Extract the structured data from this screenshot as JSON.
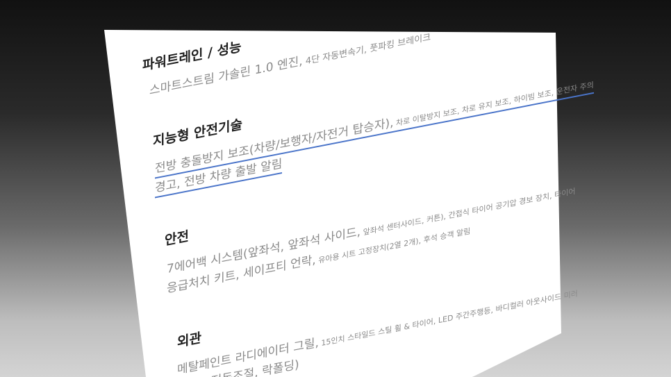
{
  "sections": [
    {
      "heading": "파워트레인 / 성능",
      "line1_main": "스마트스트림 가솔린 1.0 엔진,",
      "line1_small": " 4단 자동변속기, 풋파킹 브레이크"
    },
    {
      "heading": "지능형 안전기술",
      "line1_main": "전방 충돌방지 보조(차량/보행자/자전거 탑승자),",
      "line1_small": " 차로 이탈방지 보조, 차로 유지 보조, 하이빔 보조, 운전자 주의",
      "line2_main": "경고, 전방 차량 출발 알림",
      "line2_small": ""
    },
    {
      "heading": "안전",
      "line1_main": "7에어백 시스템(앞좌석, 앞좌석 사이드,",
      "line1_small": " 앞좌석 센터사이드, 커튼), 간접식 타이어 공기압 경보 장치, 타이어",
      "line2_main": "응급처치 키트, 세이프티 언락,",
      "line2_small": " 유아용 시트 고정장치(2열 2개), 후석 승객 알림"
    },
    {
      "heading": "외관",
      "line1_main": "메탈페인트 라디에이터 그릴,",
      "line1_small": " 15인치 스타일드 스틸 휠 & 타이어, LED 주간주행등, 바디컬러 아웃사이드 미러",
      "line2_main": "(열선, 전동조절, 락폴딩)",
      "line2_small": ""
    }
  ],
  "colors": {
    "heading": "#1f1f1f",
    "body": "#8a8a8a",
    "underline": "#4a74c9",
    "sheet": "#ffffff"
  }
}
